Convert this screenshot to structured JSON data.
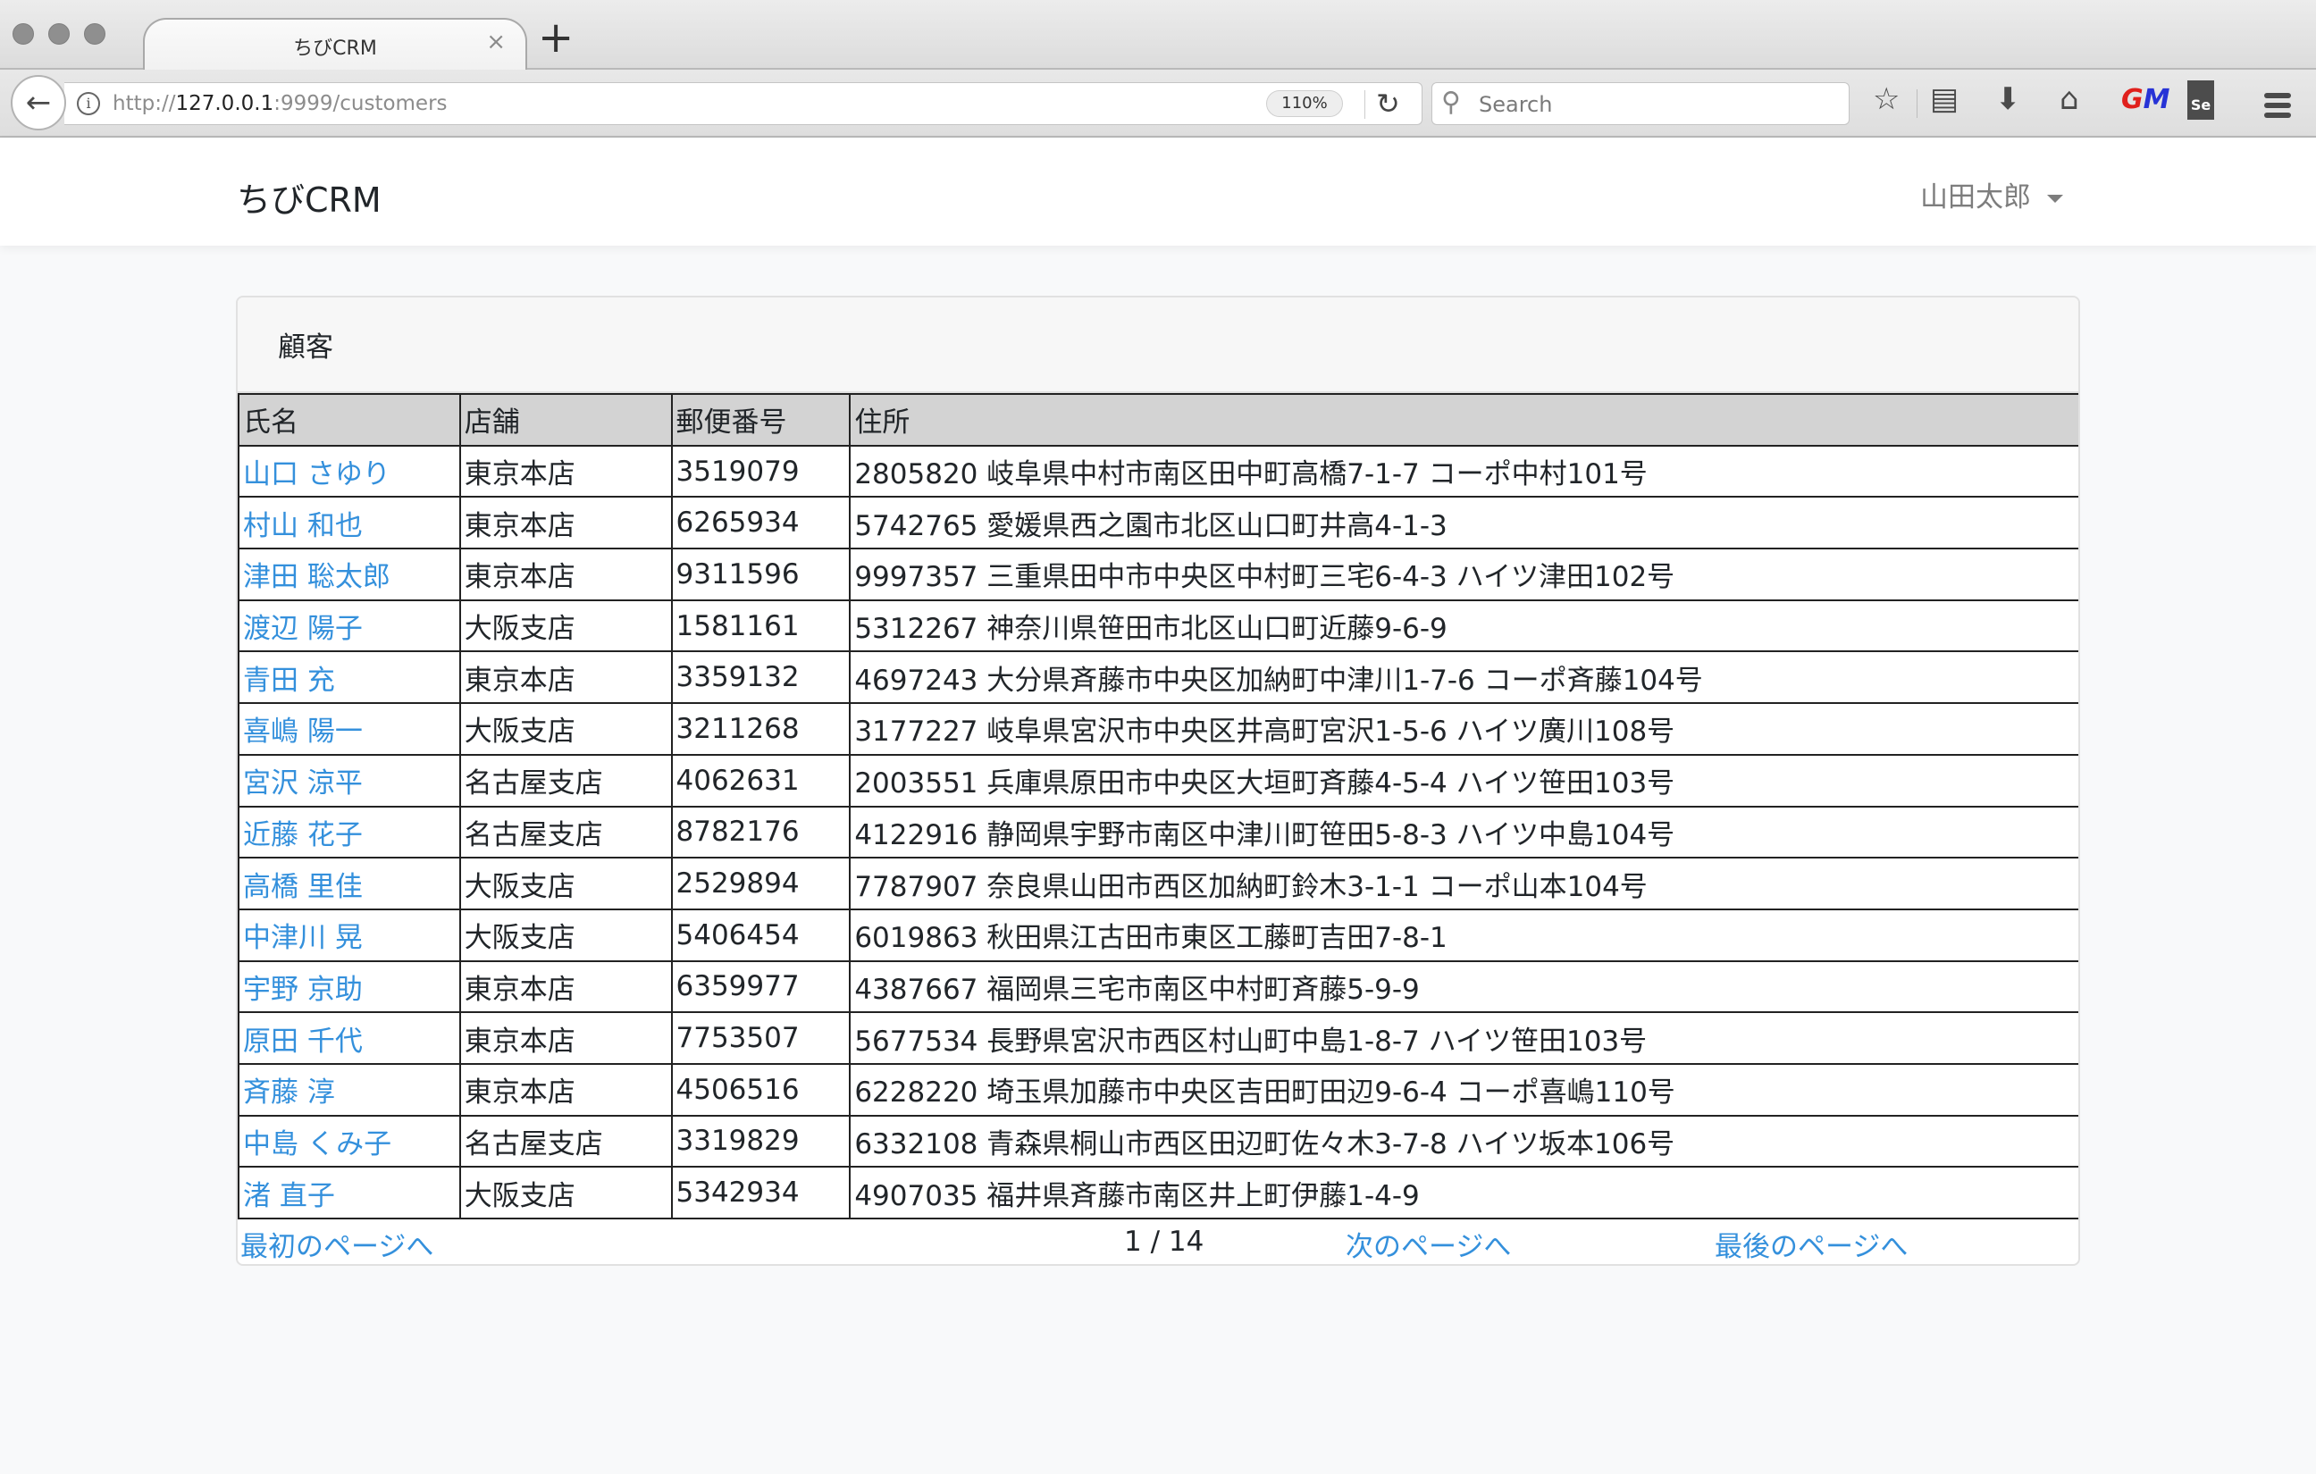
{
  "browser": {
    "tab_title": "ちびCRM",
    "tab_close": "×",
    "new_tab": "+",
    "url_scheme": "http://",
    "url_host": "127.0.0.1",
    "url_rest": ":9999/customers",
    "zoom_level": "110%",
    "search_placeholder": "Search"
  },
  "app": {
    "brand": "ちびCRM",
    "user_name": "山田太郎"
  },
  "card": {
    "title": "顧客"
  },
  "table": {
    "headers": [
      "氏名",
      "店舗",
      "郵便番号",
      "住所"
    ],
    "rows": [
      {
        "name": "山口 さゆり",
        "store": "東京本店",
        "zip": "3519079",
        "address": "2805820 岐阜県中村市南区田中町高橋7-1-7 コーポ中村101号"
      },
      {
        "name": "村山 和也",
        "store": "東京本店",
        "zip": "6265934",
        "address": "5742765 愛媛県西之園市北区山口町井高4-1-3"
      },
      {
        "name": "津田 聡太郎",
        "store": "東京本店",
        "zip": "9311596",
        "address": "9997357 三重県田中市中央区中村町三宅6-4-3 ハイツ津田102号"
      },
      {
        "name": "渡辺 陽子",
        "store": "大阪支店",
        "zip": "1581161",
        "address": "5312267 神奈川県笹田市北区山口町近藤9-6-9"
      },
      {
        "name": "青田 充",
        "store": "東京本店",
        "zip": "3359132",
        "address": "4697243 大分県斉藤市中央区加納町中津川1-7-6 コーポ斉藤104号"
      },
      {
        "name": "喜嶋 陽一",
        "store": "大阪支店",
        "zip": "3211268",
        "address": "3177227 岐阜県宮沢市中央区井高町宮沢1-5-6 ハイツ廣川108号"
      },
      {
        "name": "宮沢 涼平",
        "store": "名古屋支店",
        "zip": "4062631",
        "address": "2003551 兵庫県原田市中央区大垣町斉藤4-5-4 ハイツ笹田103号"
      },
      {
        "name": "近藤 花子",
        "store": "名古屋支店",
        "zip": "8782176",
        "address": "4122916 静岡県宇野市南区中津川町笹田5-8-3 ハイツ中島104号"
      },
      {
        "name": "高橋 里佳",
        "store": "大阪支店",
        "zip": "2529894",
        "address": "7787907 奈良県山田市西区加納町鈴木3-1-1 コーポ山本104号"
      },
      {
        "name": "中津川 晃",
        "store": "大阪支店",
        "zip": "5406454",
        "address": "6019863 秋田県江古田市東区工藤町吉田7-8-1"
      },
      {
        "name": "宇野 京助",
        "store": "東京本店",
        "zip": "6359977",
        "address": "4387667 福岡県三宅市南区中村町斉藤5-9-9"
      },
      {
        "name": "原田 千代",
        "store": "東京本店",
        "zip": "7753507",
        "address": "5677534 長野県宮沢市西区村山町中島1-8-7 ハイツ笹田103号"
      },
      {
        "name": "斉藤 淳",
        "store": "東京本店",
        "zip": "4506516",
        "address": "6228220 埼玉県加藤市中央区吉田町田辺9-6-4 コーポ喜嶋110号"
      },
      {
        "name": "中島 くみ子",
        "store": "名古屋支店",
        "zip": "3319829",
        "address": "6332108 青森県桐山市西区田辺町佐々木3-7-8 ハイツ坂本106号"
      },
      {
        "name": "渚 直子",
        "store": "大阪支店",
        "zip": "5342934",
        "address": "4907035 福井県斉藤市南区井上町伊藤1-4-9"
      }
    ]
  },
  "pagination": {
    "first_label": "最初のページへ",
    "page_info": "1 / 14",
    "next_label": "次のページへ",
    "last_label": "最後のページへ"
  },
  "colors": {
    "link": "#3490dc",
    "table_header_bg": "#d3d3d3",
    "page_bg": "#f8f9fa"
  }
}
